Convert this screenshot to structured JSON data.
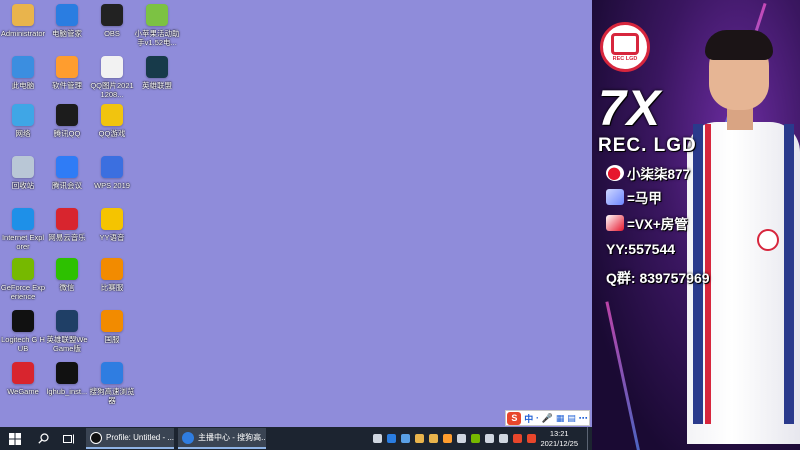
{
  "desktop_icons": [
    {
      "label": "Administrator",
      "icon": "folder-user-icon",
      "color": "#e9b44c"
    },
    {
      "label": "电脑管家",
      "icon": "shield-icon",
      "color": "#2a7de1"
    },
    {
      "label": "OBS",
      "icon": "obs-icon",
      "color": "#222222"
    },
    {
      "label": "小苹果活动助手v1.52电...",
      "icon": "apple-icon",
      "color": "#7cc243"
    },
    {
      "label": "此电脑",
      "icon": "computer-icon",
      "color": "#3b8ee0"
    },
    {
      "label": "软件管理",
      "icon": "apps-icon",
      "color": "#ff9d2e"
    },
    {
      "label": "QQ图片20211208...",
      "icon": "image-file-icon",
      "color": "#f2f2f2"
    },
    {
      "label": "英雄联盟",
      "icon": "lol-icon",
      "color": "#173a4a"
    },
    {
      "label": "网络",
      "icon": "network-icon",
      "color": "#3fa6e6"
    },
    {
      "label": "腾讯QQ",
      "icon": "qq-penguin-icon",
      "color": "#1c1c1c"
    },
    {
      "label": "QQ游戏",
      "icon": "qq-game-icon",
      "color": "#f1c40f"
    },
    {
      "label": "回收站",
      "icon": "recycle-bin-icon",
      "color": "#b9c7d6"
    },
    {
      "label": "腾讯会议",
      "icon": "meeting-icon",
      "color": "#2f7cf6"
    },
    {
      "label": "WPS 2019",
      "icon": "wps-icon",
      "color": "#3b6fe0"
    },
    {
      "label": "Internet Explorer",
      "icon": "ie-icon",
      "color": "#1e90e8"
    },
    {
      "label": "网易云音乐",
      "icon": "music-icon",
      "color": "#d8252e"
    },
    {
      "label": "YY语音",
      "icon": "yy-icon",
      "color": "#f5c400"
    },
    {
      "label": "GeForce Experience",
      "icon": "nvidia-icon",
      "color": "#76b900"
    },
    {
      "label": "微信",
      "icon": "wechat-icon",
      "color": "#2dc100"
    },
    {
      "label": "比赛服",
      "icon": "tencent-game-icon",
      "color": "#f28b00"
    },
    {
      "label": "Logitech G HUB",
      "icon": "logitech-icon",
      "color": "#111111"
    },
    {
      "label": "英雄联盟WeGame版",
      "icon": "lol-icon",
      "color": "#1f3f66"
    },
    {
      "label": "国服",
      "icon": "tencent-game-icon",
      "color": "#f28b00"
    },
    {
      "label": "WeGame",
      "icon": "wegame-icon",
      "color": "#d8252e"
    },
    {
      "label": "lghub_inst...",
      "icon": "logitech-icon",
      "color": "#111111"
    },
    {
      "label": "搜狗高速浏览器",
      "icon": "sogou-browser-icon",
      "color": "#2f7de1"
    }
  ],
  "streamer_panel": {
    "logo_text": "REC LGD",
    "big_name": "7X",
    "team": "REC. LGD",
    "weibo": "小柒柒877",
    "alt_account": "=马甲",
    "contact": "=VX+房管",
    "yy": "YY:557544",
    "qq_group": "Q群: 839757969"
  },
  "ime_toolbar": {
    "logo": "S",
    "items": [
      "中",
      "·",
      "🎤",
      "▦",
      "▤",
      "⋯"
    ]
  },
  "taskbar": {
    "apps": [
      {
        "label": "Profile: Untitled - ...",
        "icon": "obs-icon",
        "color": "#ffffff"
      },
      {
        "label": "主播中心 - 搜狗高...",
        "icon": "sogou-browser-icon",
        "color": "#2f7de1"
      }
    ],
    "tray_icons": [
      "chevron-up-icon",
      "shield-icon",
      "display-icon",
      "folder-icon",
      "folder-icon",
      "shield-icon",
      "steam-icon",
      "nvidia-icon",
      "network-icon",
      "volume-icon",
      "keyboard-icon",
      "sogou-icon"
    ],
    "tray_colors": [
      "#cfd6e0",
      "#2a7de1",
      "#5aa0e6",
      "#e9b44c",
      "#e9b44c",
      "#ff9d2e",
      "#cfd6e0",
      "#76b900",
      "#cfd6e0",
      "#cfd6e0",
      "#e8462b",
      "#e8462b"
    ],
    "time": "13:21",
    "date": "2021/12/25"
  }
}
